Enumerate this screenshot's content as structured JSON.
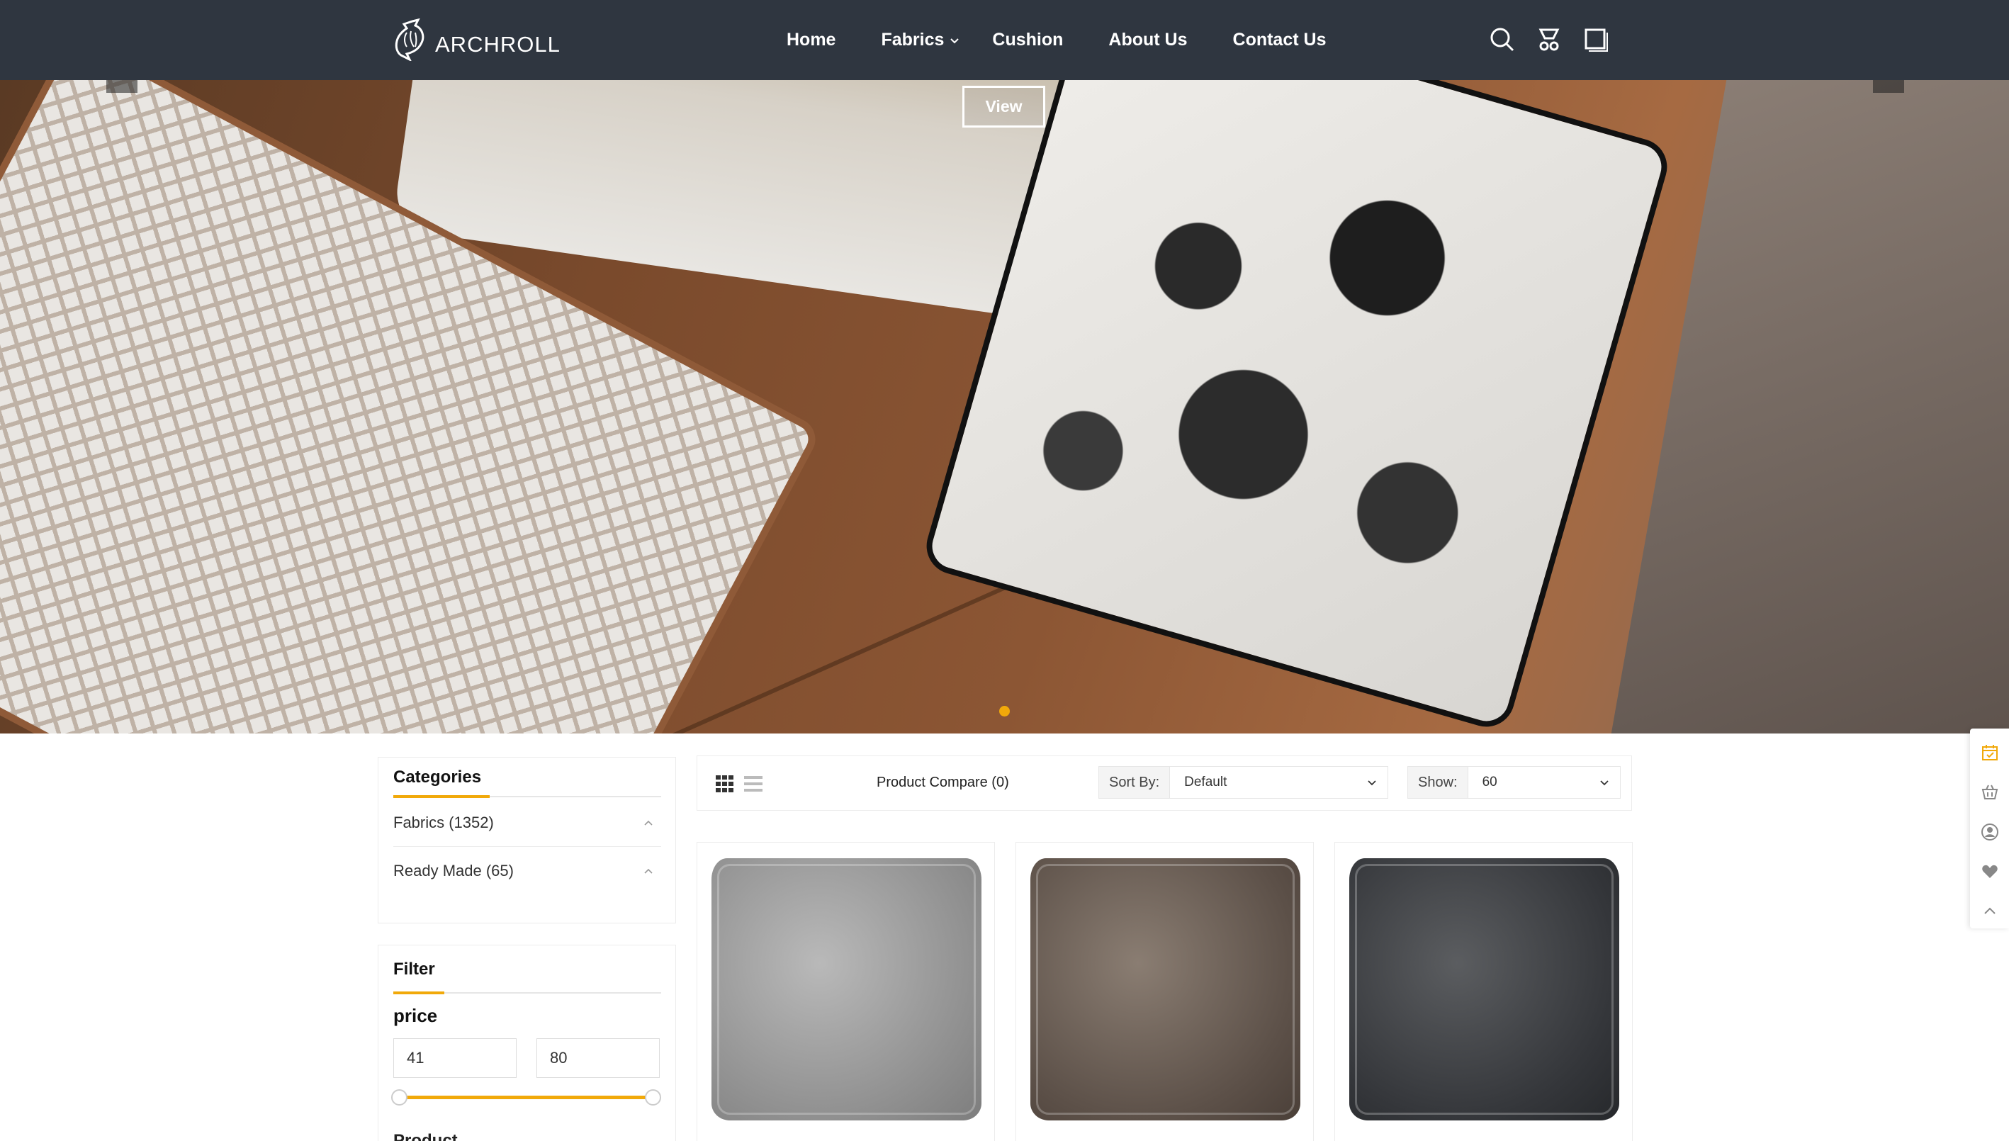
{
  "header": {
    "logo_text": "ARCHROLL",
    "nav": [
      {
        "label": "Home"
      },
      {
        "label": "Fabrics"
      },
      {
        "label": "Cushion"
      },
      {
        "label": "About Us"
      },
      {
        "label": "Contact Us"
      }
    ],
    "icons": [
      "search-icon",
      "wishlist-icon",
      "compare-icon"
    ]
  },
  "hero": {
    "button_label": "View",
    "slides_total": 1,
    "active_slide": 1
  },
  "categories": {
    "title": "Categories",
    "items": [
      {
        "label": "Fabrics (1352)"
      },
      {
        "label": "Ready Made (65)"
      }
    ]
  },
  "filter": {
    "title": "Filter",
    "price_label": "price",
    "min_value": "41",
    "max_value": "80",
    "next_section_partial": "Product"
  },
  "toolbar": {
    "compare_label": "Product Compare (0)",
    "sort_label": "Sort By:",
    "sort_value": "Default",
    "show_label": "Show:",
    "show_value": "60"
  },
  "products": [
    {
      "color": "#9e9e9e"
    },
    {
      "color": "#6b5e54"
    },
    {
      "color": "#3a3c40"
    }
  ],
  "side_bar": {
    "icons": [
      "calendar-check-icon",
      "cart-icon",
      "user-icon",
      "heart-icon",
      "chevron-up-icon"
    ]
  },
  "colors": {
    "header_bg": "#2f3640",
    "accent": "#f1a90a"
  }
}
